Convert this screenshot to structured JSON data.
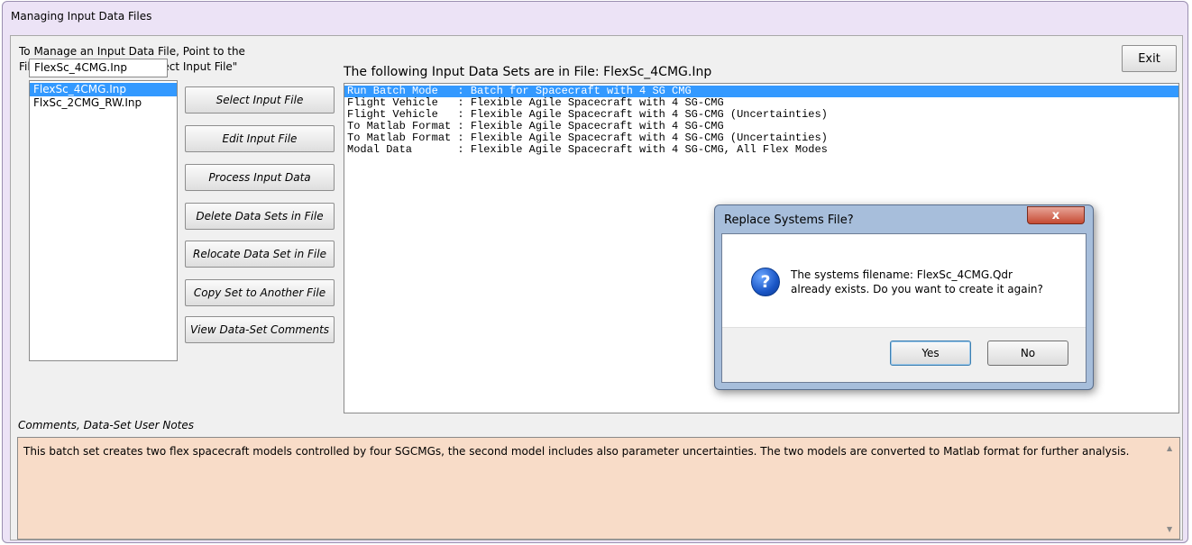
{
  "window": {
    "title": "Managing Input Data Files"
  },
  "instructions": {
    "line1": "To Manage an Input Data File, Point to the",
    "line2": "Filename and Click on \"Select Input File\""
  },
  "exit_label": "Exit",
  "filename_box": "FlexSc_4CMG.Inp",
  "files": [
    {
      "name": "FlexSc_4CMG.Inp",
      "selected": true
    },
    {
      "name": "FlxSc_2CMG_RW.Inp",
      "selected": false
    }
  ],
  "buttons": [
    "Select Input File",
    "Edit Input File",
    "Process Input Data",
    "Delete Data Sets in File",
    "Relocate Data Set in File",
    "Copy Set to Another File",
    "View Data-Set Comments"
  ],
  "datasets_title": "The following Input Data Sets are in File: FlexSc_4CMG.Inp",
  "datasets": [
    {
      "text": "Run Batch Mode   : Batch for Spacecraft with 4 SG CMG",
      "selected": true
    },
    {
      "text": "Flight Vehicle   : Flexible Agile Spacecraft with 4 SG-CMG",
      "selected": false
    },
    {
      "text": "Flight Vehicle   : Flexible Agile Spacecraft with 4 SG-CMG (Uncertainties)",
      "selected": false
    },
    {
      "text": "To Matlab Format : Flexible Agile Spacecraft with 4 SG-CMG",
      "selected": false
    },
    {
      "text": "To Matlab Format : Flexible Agile Spacecraft with 4 SG-CMG (Uncertainties)",
      "selected": false
    },
    {
      "text": "Modal Data       : Flexible Agile Spacecraft with 4 SG-CMG, All Flex Modes",
      "selected": false
    }
  ],
  "comments": {
    "label": "Comments, Data-Set User Notes",
    "text": "This batch set creates two flex spacecraft models controlled by four SGCMGs,  the second model includes also parameter uncertainties. The two models are  converted to Matlab format for further analysis."
  },
  "dialog": {
    "title": "Replace Systems File?",
    "close_glyph": "x",
    "icon_glyph": "?",
    "message_line1": "The systems filename: FlexSc_4CMG.Qdr",
    "message_line2": "already exists. Do you want to create it again?",
    "yes_label": "Yes",
    "no_label": "No"
  },
  "colors": {
    "window_bg": "#ece3f6",
    "selection": "#3399ff",
    "comments_bg": "#f8dcc8",
    "dialog_frame": "#a7bedb",
    "close_button": "#c54b33"
  }
}
